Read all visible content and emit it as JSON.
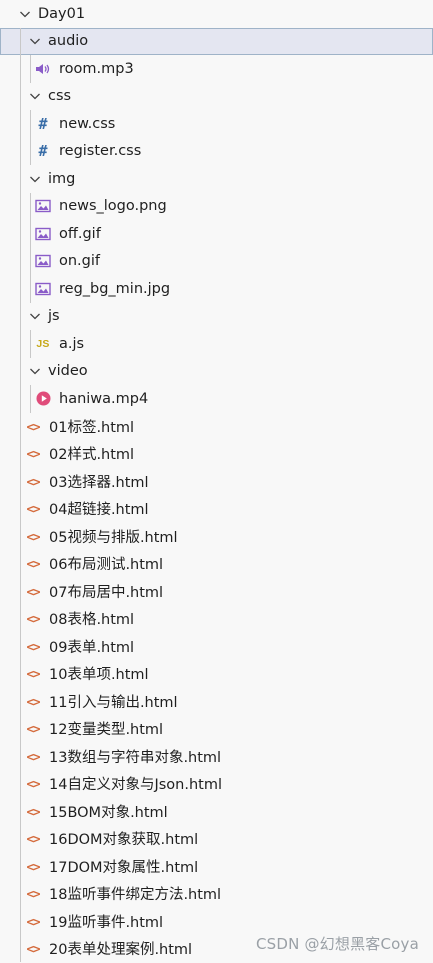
{
  "root": {
    "label": "Day01",
    "folders": [
      {
        "label": "audio",
        "files": [
          {
            "label": "room.mp3",
            "icon": "audio-icon"
          }
        ]
      },
      {
        "label": "css",
        "files": [
          {
            "label": "new.css",
            "icon": "css-hash-icon"
          },
          {
            "label": "register.css",
            "icon": "css-hash-icon"
          }
        ]
      },
      {
        "label": "img",
        "files": [
          {
            "label": "news_logo.png",
            "icon": "image-icon"
          },
          {
            "label": "off.gif",
            "icon": "image-icon"
          },
          {
            "label": "on.gif",
            "icon": "image-icon"
          },
          {
            "label": "reg_bg_min.jpg",
            "icon": "image-icon"
          }
        ]
      },
      {
        "label": "js",
        "files": [
          {
            "label": "a.js",
            "icon": "js-icon"
          }
        ]
      },
      {
        "label": "video",
        "files": [
          {
            "label": "haniwa.mp4",
            "icon": "video-play-icon"
          }
        ]
      }
    ],
    "html_files": [
      "01标签.html",
      "02样式.html",
      "03选择器.html",
      "04超链接.html",
      "05视频与排版.html",
      "06布局测试.html",
      "07布局居中.html",
      "08表格.html",
      "09表单.html",
      "10表单项.html",
      "11引入与输出.html",
      "12变量类型.html",
      "13数组与字符串对象.html",
      "14自定义对象与Json.html",
      "15BOM对象.html",
      "16DOM对象获取.html",
      "17DOM对象属性.html",
      "18监听事件绑定方法.html",
      "19监听事件.html",
      "20表单处理案例.html"
    ]
  },
  "icons": {
    "html_glyph": "<>",
    "css_glyph": "#",
    "js_glyph": "JS"
  },
  "colors": {
    "selected_bg": "#e4e6f1",
    "html_icon": "#d4693a",
    "css_icon": "#3a6ea8",
    "js_icon": "#c7a918",
    "media_icon": "#8a5cc8",
    "video_icon": "#e04c7a"
  },
  "watermark": "CSDN @幻想黑客Coya"
}
